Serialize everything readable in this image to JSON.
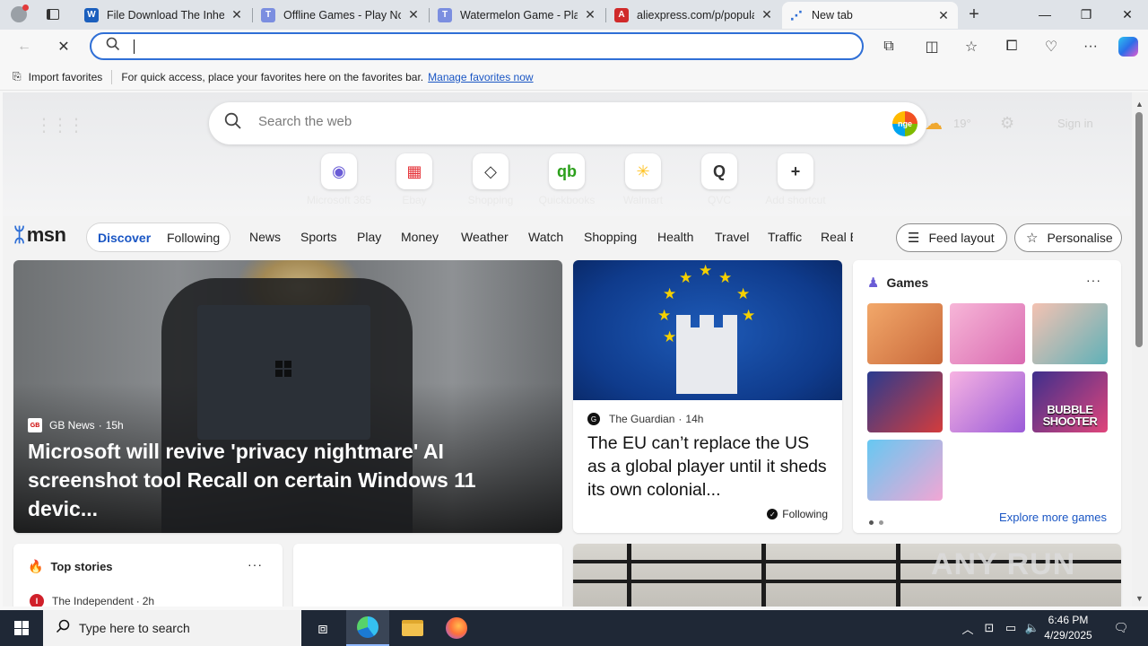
{
  "tabs": [
    {
      "title": "File Download The Inheri",
      "favicon_color": "#1b5fbd",
      "favicon_glyph": "W"
    },
    {
      "title": "Offline Games - Play No",
      "favicon_color": "#7b8ee0",
      "favicon_glyph": "T"
    },
    {
      "title": "Watermelon Game - Play",
      "favicon_color": "#7b8ee0",
      "favicon_glyph": "T"
    },
    {
      "title": "aliexpress.com/p/popula",
      "favicon_color": "#d02a2a",
      "favicon_glyph": "A"
    },
    {
      "title": "New tab",
      "favicon_color": "#2f6fd6",
      "favicon_glyph": "⋰"
    }
  ],
  "address_bar": {
    "value": "",
    "placeholder": ""
  },
  "favorites_bar": {
    "import_label": "Import favorites",
    "hint": "For quick access, place your favorites here on the favorites bar.",
    "manage_link": "Manage favorites now"
  },
  "newtab": {
    "search_placeholder": "Search the web",
    "weather_temp": "19°",
    "signin_label": "Sign in",
    "shortcuts": [
      {
        "label": "Microsoft 365",
        "glyph": "◉",
        "color": "#6a5cd6"
      },
      {
        "label": "Ebay",
        "glyph": "▦",
        "color": "#e53238"
      },
      {
        "label": "Shopping",
        "glyph": "◇",
        "color": "#333333"
      },
      {
        "label": "Quickbooks",
        "glyph": "qb",
        "color": "#2ca01c"
      },
      {
        "label": "Walmart",
        "glyph": "✳",
        "color": "#ffc220"
      },
      {
        "label": "QVC",
        "glyph": "Q",
        "color": "#333333"
      },
      {
        "label": "Add shortcut",
        "glyph": "+",
        "color": "#333333"
      }
    ]
  },
  "msn": {
    "logo_text": "msn",
    "tabs": [
      {
        "label": "Discover",
        "active": true
      },
      {
        "label": "Following",
        "active": false
      }
    ],
    "categories": [
      "News",
      "Sports",
      "Play",
      "Money",
      "Weather",
      "Watch",
      "Shopping",
      "Health",
      "Travel",
      "Traffic",
      "Real E"
    ],
    "feed_layout_label": "Feed layout",
    "personalise_label": "Personalise"
  },
  "hero_story": {
    "source": "GB News",
    "source_logo": "GB",
    "age": "15h",
    "title": "Microsoft will revive 'privacy nightmare' AI screenshot tool Recall on certain Windows 11 devic..."
  },
  "eu_story": {
    "source": "The Guardian",
    "source_logo": "G",
    "age": "14h",
    "title": "The EU can’t replace the US as a global player until it sheds its own colonial...",
    "follow_label": "Following"
  },
  "games": {
    "heading": "Games",
    "explore_label": "Explore more games",
    "tiles": [
      {
        "text": "",
        "color_a": "#f2a86a",
        "color_b": "#c9683a"
      },
      {
        "text": "",
        "color_a": "#f7b6d8",
        "color_b": "#d96ab0"
      },
      {
        "text": "",
        "color_a": "#f4c2b2",
        "color_b": "#5fb1b8"
      },
      {
        "text": "",
        "color_a": "#2a3b8f",
        "color_b": "#d43c3c"
      },
      {
        "text": "",
        "color_a": "#f7b3e2",
        "color_b": "#9a5bd8"
      },
      {
        "text": "BUBBLE SHOOTER",
        "color_a": "#3e2f8c",
        "color_b": "#e0457b"
      },
      {
        "text": "",
        "color_a": "#66c8f2",
        "color_b": "#f2a6d4"
      }
    ]
  },
  "top_stories": {
    "heading": "Top stories",
    "source": "The Independent",
    "source_logo": "I",
    "age": "2h"
  },
  "watermark": "ANY RUN",
  "taskbar": {
    "search_placeholder": "Type here to search",
    "time": "6:46 PM",
    "date": "4/29/2025"
  }
}
